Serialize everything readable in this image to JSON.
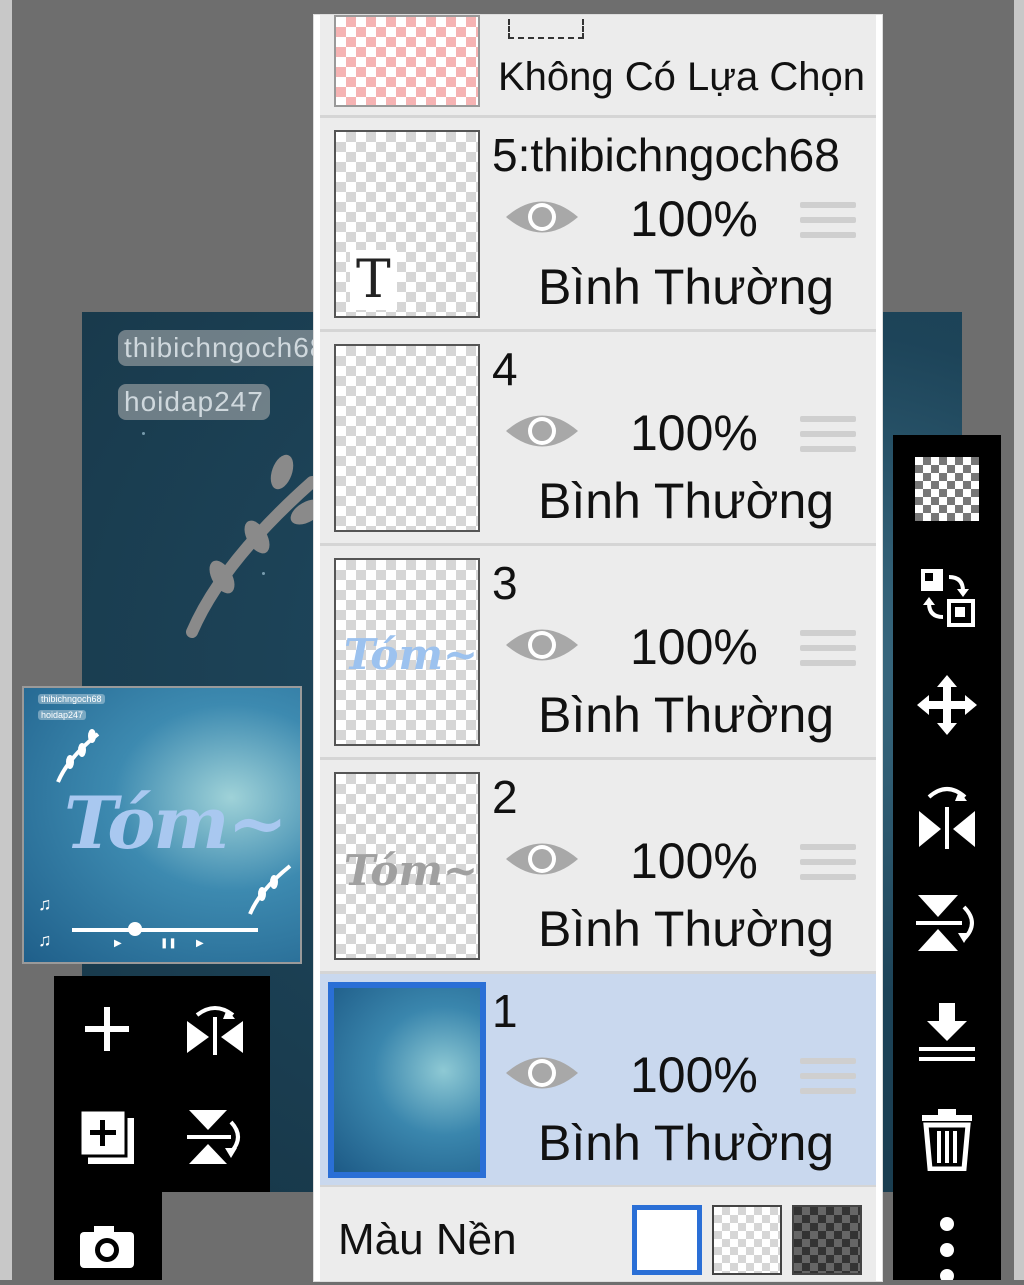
{
  "canvas": {
    "watermark_1": "thibichngoch68",
    "watermark_2": "hoidap247"
  },
  "selection_row": {
    "label": "Không Có Lựa Chọn"
  },
  "layers": [
    {
      "name": "5:thibichngoch68",
      "opacity": "100%",
      "blend": "Bình Thường",
      "thumb_text": "T",
      "selected": false
    },
    {
      "name": "4",
      "opacity": "100%",
      "blend": "Bình Thường",
      "selected": false
    },
    {
      "name": "3",
      "opacity": "100%",
      "blend": "Bình Thường",
      "thumb_text": "Tóm~",
      "selected": false
    },
    {
      "name": "2",
      "opacity": "100%",
      "blend": "Bình Thường",
      "thumb_text": "Tóm~",
      "selected": false
    },
    {
      "name": "1",
      "opacity": "100%",
      "blend": "Bình Thường",
      "selected": true
    }
  ],
  "background_row": {
    "label": "Màu Nền",
    "options": [
      "white",
      "transparent",
      "dark"
    ],
    "selected": "white"
  },
  "preview": {
    "title": "Tóm~",
    "watermark_1": "thibichngoch68",
    "watermark_2": "hoidap247"
  },
  "right_toolbar": [
    "transparency-checker-icon",
    "swap-layers-icon",
    "move-icon",
    "flip-horizontal-icon",
    "flip-vertical-icon",
    "merge-down-icon",
    "trash-icon",
    "more-vertical-icon"
  ],
  "left_toolbar": [
    "add-layer-icon",
    "flip-horizontal-icon",
    "duplicate-layer-icon",
    "flip-vertical-icon",
    "camera-icon"
  ],
  "colors": {
    "accent": "#2a6fd6",
    "selected_layer": "#c9d8ee",
    "toolbar_bg": "#000000"
  }
}
